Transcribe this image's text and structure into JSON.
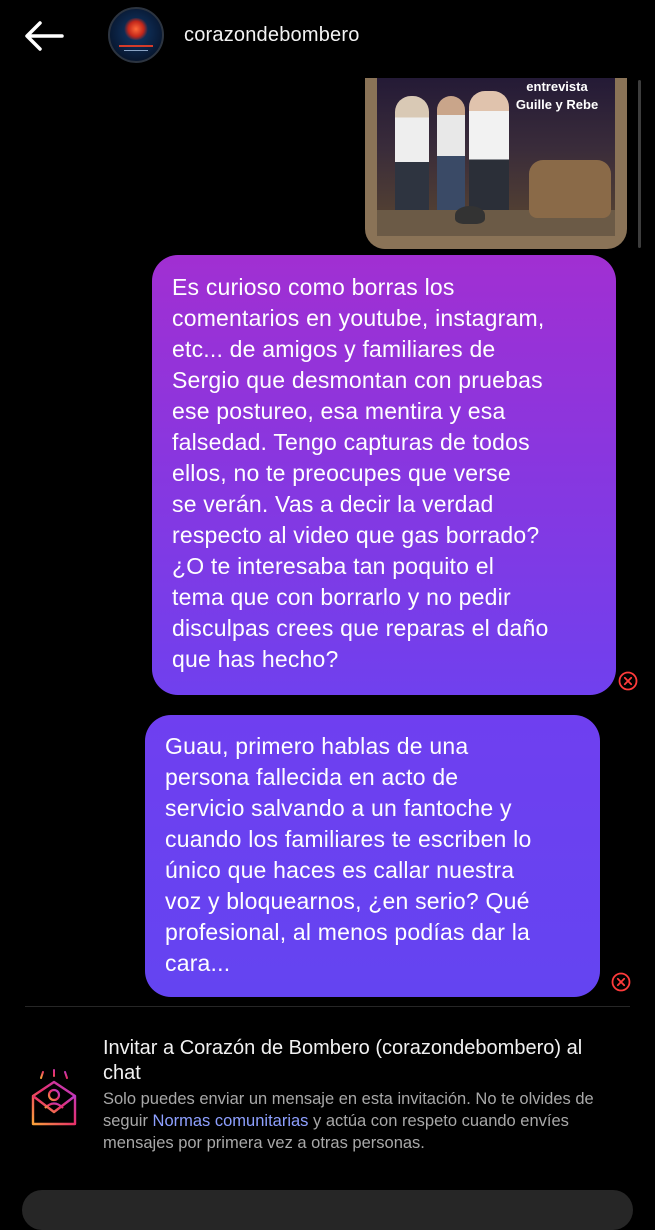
{
  "header": {
    "username": "corazondebombero"
  },
  "shared_photo": {
    "caption_line1": "entrevista",
    "caption_line2": "Guille y Rebe"
  },
  "messages": [
    {
      "lines": [
        "Es curioso como borras los",
        "comentarios en youtube, instagram,",
        "etc... de amigos y familiares de",
        "Sergio que desmontan con pruebas",
        "ese postureo, esa mentira y esa",
        "falsedad. Tengo capturas de todos",
        "ellos, no te preocupes que verse",
        "se verán. Vas a decir la verdad",
        "respecto al video que gas borrado?",
        "¿O te interesaba tan poquito el",
        "tema que con borrarlo y no pedir",
        "disculpas crees que reparas el daño",
        "que has hecho?"
      ],
      "status_icon": "error-icon"
    },
    {
      "lines": [
        "Guau, primero hablas de una",
        "persona fallecida en acto de",
        "servicio salvando a un fantoche y",
        "cuando los familiares te escriben lo",
        "único que haces es callar nuestra",
        "voz y bloquearnos, ¿en serio? Qué",
        "profesional, al menos podías dar la",
        "cara..."
      ],
      "status_icon": "error-icon"
    }
  ],
  "invite": {
    "title": "Invitar a Corazón de Bombero (corazondebombero) al chat",
    "body_before_link": "Solo puedes enviar un mensaje en esta invitación. No te olvides de seguir ",
    "link_text": "Normas comunitarias",
    "body_after_link": " y actúa con respeto cuando envíes mensajes por primera vez a otras personas.",
    "icon": "envelope-invite-icon"
  },
  "colors": {
    "background": "#000000",
    "bubble_top": "#a12fd2",
    "bubble_bottom": "#6444f1",
    "error": "#ff3b3b",
    "link": "#8ea0ff"
  }
}
